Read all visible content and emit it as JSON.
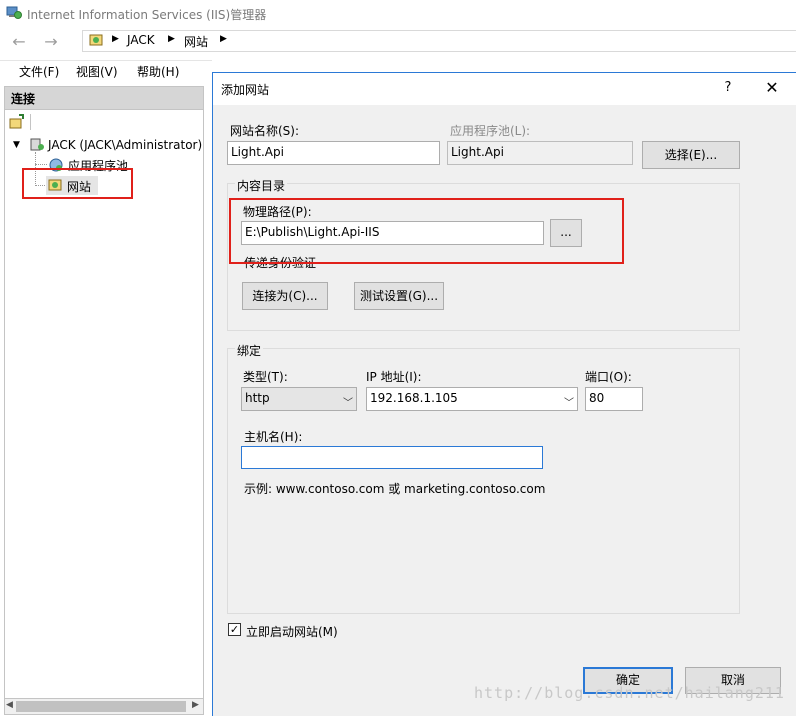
{
  "window": {
    "title": "Internet Information Services (IIS)管理器"
  },
  "address": {
    "crumbs": [
      "JACK",
      "网站"
    ]
  },
  "menu": {
    "items": [
      "文件(F)",
      "视图(V)",
      "帮助(H)"
    ]
  },
  "connections": {
    "title": "连接",
    "tree": {
      "server": "JACK (JACK\\Administrator)",
      "app_pools": "应用程序池",
      "sites": "网站"
    }
  },
  "dialog": {
    "title": "添加网站",
    "help": "?",
    "close": "✕",
    "site_name_label": "网站名称(S):",
    "site_name_value": "Light.Api",
    "app_pool_label": "应用程序池(L):",
    "app_pool_value": "Light.Api",
    "select_button": "选择(E)...",
    "content_dir_label": "内容目录",
    "physical_path_label": "物理路径(P):",
    "physical_path_value": "E:\\Publish\\Light.Api-IIS",
    "browse_button": "...",
    "pass_through_label": "传递身份验证",
    "connect_as_button": "连接为(C)...",
    "test_settings_button": "测试设置(G)...",
    "binding_label": "绑定",
    "type_label": "类型(T):",
    "type_value": "http",
    "ip_label": "IP 地址(I):",
    "ip_value": "192.168.1.105",
    "port_label": "端口(O):",
    "port_value": "80",
    "hostname_label": "主机名(H):",
    "hostname_value": "",
    "example_text": "示例: www.contoso.com 或 marketing.contoso.com",
    "start_now_label": "立即启动网站(M)",
    "start_now_checked": true,
    "ok_button": "确定",
    "cancel_button": "取消"
  },
  "watermark": "http://blog.csdn.net/hailang211",
  "colors": {
    "highlight_red": "#e0201a",
    "dialog_border": "#2b79d6"
  }
}
